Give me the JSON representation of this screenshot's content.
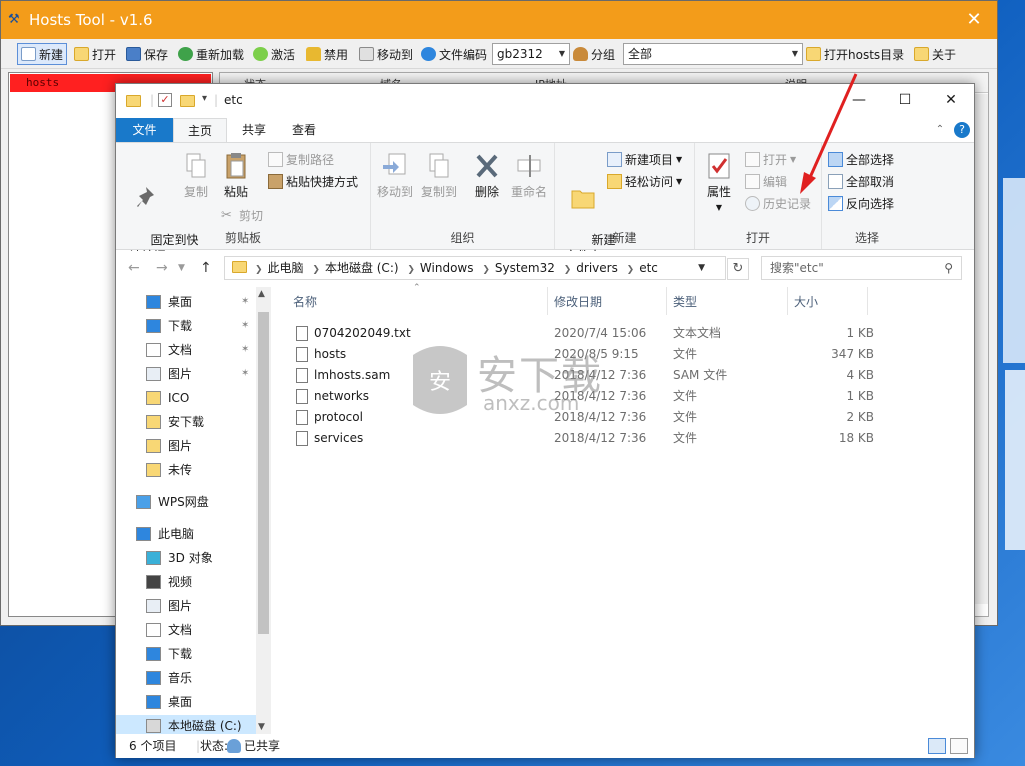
{
  "hosts_tool": {
    "title": "Hosts Tool - v1.6",
    "toolbar": {
      "new": "新建",
      "open": "打开",
      "save": "保存",
      "reload": "重新加载",
      "activate": "激活",
      "disable": "禁用",
      "move_to": "移动到",
      "file_encoding": "文件编码",
      "encoding_value": "gb2312",
      "group": "分组",
      "group_value": "全部",
      "open_hosts_dir": "打开hosts目录",
      "about": "关于"
    },
    "left_list": [
      "hosts"
    ],
    "grid_headers": [
      "状态",
      "域名",
      "IP地址",
      "说明"
    ]
  },
  "explorer": {
    "title": "etc",
    "tabs": [
      "文件",
      "主页",
      "共享",
      "查看"
    ],
    "ribbon": {
      "clipboard": {
        "label": "剪贴板",
        "pin": "固定到快\n速访问",
        "copy": "复制",
        "paste": "粘贴",
        "copy_path": "复制路径",
        "paste_shortcut": "粘贴快捷方式",
        "cut": "剪切"
      },
      "organize": {
        "label": "组织",
        "move_to": "移动到",
        "copy_to": "复制到",
        "delete": "删除",
        "rename": "重命名"
      },
      "new": {
        "label": "新建",
        "new_folder": "新建\n文件夹",
        "new_item": "新建项目",
        "easy_access": "轻松访问"
      },
      "open": {
        "label": "打开",
        "properties": "属性",
        "open": "打开",
        "edit": "编辑",
        "history": "历史记录"
      },
      "select": {
        "label": "选择",
        "select_all": "全部选择",
        "select_none": "全部取消",
        "invert": "反向选择"
      }
    },
    "address": [
      "此电脑",
      "本地磁盘 (C:)",
      "Windows",
      "System32",
      "drivers",
      "etc"
    ],
    "search_placeholder": "搜索\"etc\"",
    "nav": [
      {
        "label": "桌面",
        "pinned": true,
        "icon": "desktop-icon"
      },
      {
        "label": "下载",
        "pinned": true,
        "icon": "download-icon"
      },
      {
        "label": "文档",
        "pinned": true,
        "icon": "document-icon"
      },
      {
        "label": "图片",
        "pinned": true,
        "icon": "picture-icon"
      },
      {
        "label": "ICO",
        "pinned": false,
        "icon": "folder-icon"
      },
      {
        "label": "安下载",
        "pinned": false,
        "icon": "folder-icon"
      },
      {
        "label": "图片",
        "pinned": false,
        "icon": "folder-icon"
      },
      {
        "label": "未传",
        "pinned": false,
        "icon": "folder-icon"
      },
      {
        "label": "WPS网盘",
        "pinned": false,
        "icon": "cloud-icon"
      },
      {
        "label": "此电脑",
        "pinned": false,
        "icon": "computer-icon"
      },
      {
        "label": "3D 对象",
        "pinned": false,
        "icon": "3d-objects-icon"
      },
      {
        "label": "视频",
        "pinned": false,
        "icon": "video-icon"
      },
      {
        "label": "图片",
        "pinned": false,
        "icon": "picture-icon"
      },
      {
        "label": "文档",
        "pinned": false,
        "icon": "document-icon"
      },
      {
        "label": "下载",
        "pinned": false,
        "icon": "download-icon"
      },
      {
        "label": "音乐",
        "pinned": false,
        "icon": "music-icon"
      },
      {
        "label": "桌面",
        "pinned": false,
        "icon": "desktop-icon"
      },
      {
        "label": "本地磁盘 (C:)",
        "pinned": false,
        "icon": "drive-icon"
      }
    ],
    "columns": [
      "名称",
      "修改日期",
      "类型",
      "大小"
    ],
    "files": [
      {
        "name": "0704202049.txt",
        "date": "2020/7/4 15:06",
        "type": "文本文档",
        "size": "1 KB"
      },
      {
        "name": "hosts",
        "date": "2020/8/5 9:15",
        "type": "文件",
        "size": "347 KB"
      },
      {
        "name": "lmhosts.sam",
        "date": "2018/4/12 7:36",
        "type": "SAM 文件",
        "size": "4 KB"
      },
      {
        "name": "networks",
        "date": "2018/4/12 7:36",
        "type": "文件",
        "size": "1 KB"
      },
      {
        "name": "protocol",
        "date": "2018/4/12 7:36",
        "type": "文件",
        "size": "2 KB"
      },
      {
        "name": "services",
        "date": "2018/4/12 7:36",
        "type": "文件",
        "size": "18 KB"
      }
    ],
    "status": {
      "count": "6 个项目",
      "state_label": "状态:",
      "state_value": "已共享"
    }
  },
  "watermark": {
    "text": "安下载",
    "sub": "anxz.com"
  },
  "colors": {
    "titlebar": "#f39c1a",
    "ribbon_file_tab": "#1979ca",
    "hosts_selected": "#ff2020",
    "arrow": "#e02020"
  }
}
